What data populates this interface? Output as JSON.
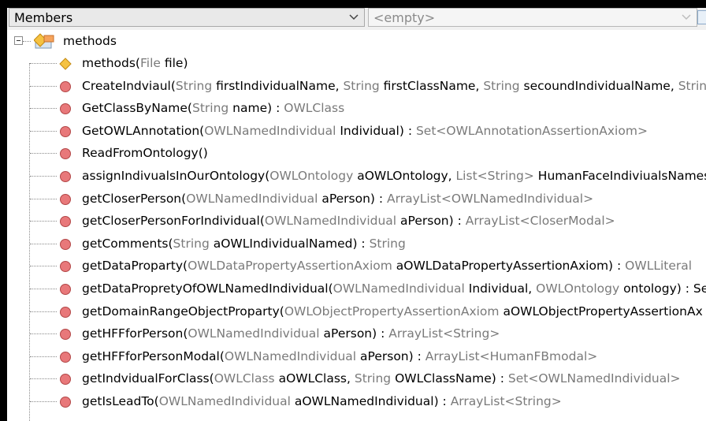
{
  "toolbar": {
    "members_label": "Members",
    "filter_value": "<empty>"
  },
  "tree": {
    "root_label": "methods",
    "items": [
      {
        "icon": "diamond-icon",
        "name": "methods(",
        "p1t": "File",
        "p1n": " file",
        "tail": ")",
        "ret": ""
      },
      {
        "icon": "circle-icon",
        "name": "CreateIndviaul(",
        "p1t": "String",
        "p1n": " firstIndividualName, ",
        "p2t": "String",
        "p2n": " firstClassName, ",
        "p3t": "String",
        "p3n": " secoundIndividualName, ",
        "p4t": "String",
        "tail": "",
        "ret": ""
      },
      {
        "icon": "circle-icon",
        "name": "GetClassByName(",
        "p1t": "String",
        "p1n": " name",
        "tail": ") : ",
        "ret": "OWLClass"
      },
      {
        "icon": "circle-icon",
        "name": "GetOWLAnnotation(",
        "p1t": "OWLNamedIndividual",
        "p1n": " Individual",
        "tail": ") : ",
        "ret": "Set<OWLAnnotationAssertionAxiom>"
      },
      {
        "icon": "circle-icon",
        "name": "ReadFromOntology()",
        "tail": "",
        "ret": ""
      },
      {
        "icon": "circle-icon",
        "name": "assignIndivualsInOurOntology(",
        "p1t": "OWLOntology",
        "p1n": " aOWLOntology, ",
        "p2t": "List<String>",
        "p2n": " HumanFaceIndiviualsNames",
        "tail": "",
        "ret": ""
      },
      {
        "icon": "circle-icon",
        "name": "getCloserPerson(",
        "p1t": "OWLNamedIndividual",
        "p1n": " aPerson",
        "tail": ") : ",
        "ret": "ArrayList<OWLNamedIndividual>"
      },
      {
        "icon": "circle-icon",
        "name": "getCloserPersonForIndividual(",
        "p1t": "OWLNamedIndividual",
        "p1n": " aPerson",
        "tail": ") : ",
        "ret": "ArrayList<CloserModal>"
      },
      {
        "icon": "circle-icon",
        "name": "getComments(",
        "p1t": "String",
        "p1n": " aOWLIndividualNamed",
        "tail": ") : ",
        "ret": "String"
      },
      {
        "icon": "circle-icon",
        "name": "getDataProparty(",
        "p1t": "OWLDataPropertyAssertionAxiom",
        "p1n": " aOWLDataPropertyAssertionAxiom",
        "tail": ") : ",
        "ret": "OWLLiteral"
      },
      {
        "icon": "circle-icon",
        "name": "getDataPropretyOfOWLNamedIndividual(",
        "p1t": "OWLNamedIndividual",
        "p1n": " Individual, ",
        "p2t": "OWLOntology",
        "p2n": " ontology",
        "tail": ") : Se",
        "ret": ""
      },
      {
        "icon": "circle-icon",
        "name": "getDomainRangeObjectProparty(",
        "p1t": "OWLObjectPropertyAssertionAxiom",
        "p1n": " aOWLObjectPropertyAssertionAx",
        "tail": "",
        "ret": ""
      },
      {
        "icon": "circle-icon",
        "name": "getHFFforPerson(",
        "p1t": "OWLNamedIndividual",
        "p1n": " aPerson",
        "tail": ") : ",
        "ret": "ArrayList<String>"
      },
      {
        "icon": "circle-icon",
        "name": "getHFFforPersonModal(",
        "p1t": "OWLNamedIndividual",
        "p1n": " aPerson",
        "tail": ") : ",
        "ret": "ArrayList<HumanFBmodal>"
      },
      {
        "icon": "circle-icon",
        "name": "getIndvidualForClass(",
        "p1t": "OWLClass",
        "p1n": " aOWLClass, ",
        "p2t": "String",
        "p2n": " OWLClassName",
        "tail": ") : ",
        "ret": "Set<OWLNamedIndividual>"
      },
      {
        "icon": "circle-icon",
        "name": "getIsLeadTo(",
        "p1t": "OWLNamedIndividual",
        "p1n": " aOWLNamedIndividual",
        "tail": ") : ",
        "ret": "ArrayList<String>"
      }
    ]
  },
  "colors": {
    "circle_fill": "#e8787a",
    "circle_stroke": "#b24747",
    "diamond_fill": "#f5c242",
    "diamond_stroke": "#c48a12"
  }
}
